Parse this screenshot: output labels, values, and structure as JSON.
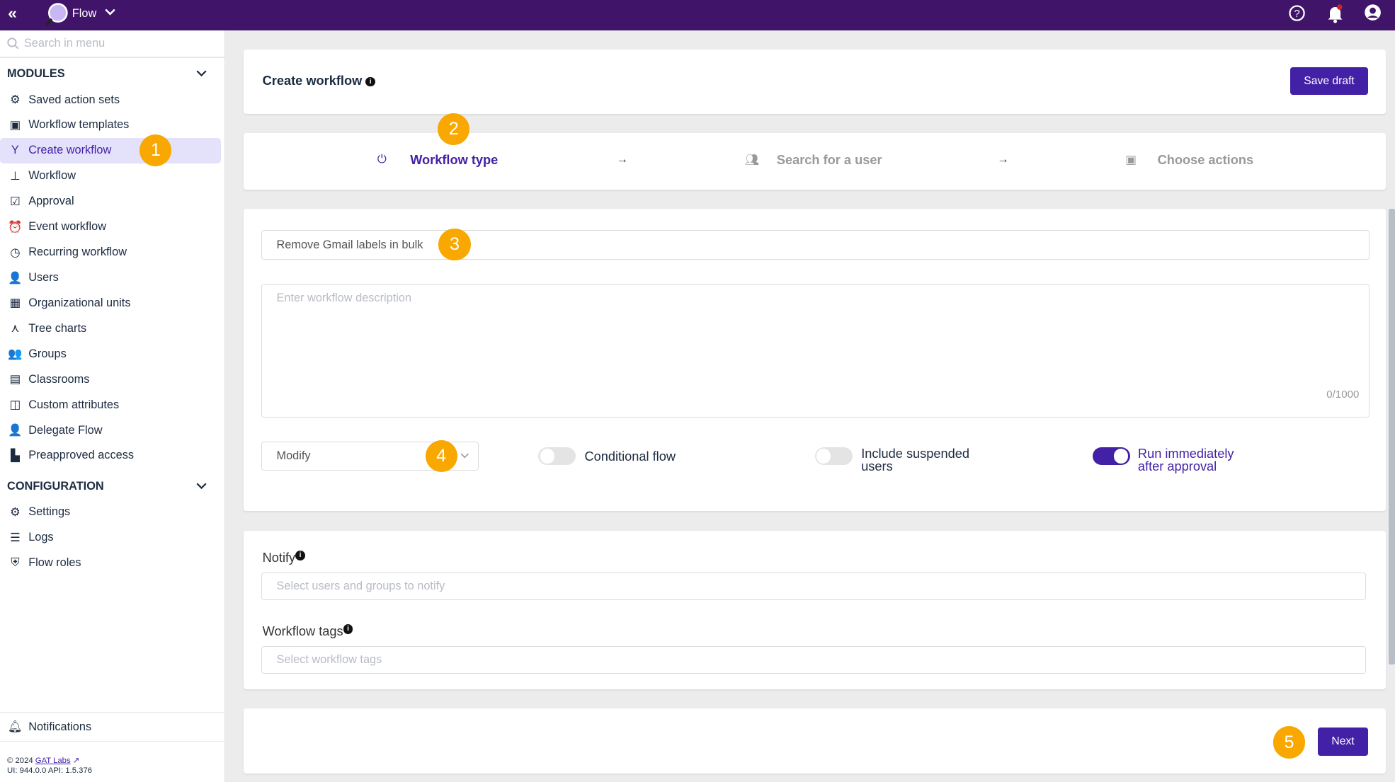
{
  "topbar": {
    "app_name": "Flow",
    "icons": [
      "collapse-icon",
      "flow-logo",
      "chevron-down-icon",
      "help-icon",
      "bell-icon",
      "account-icon"
    ],
    "background": "#3f1469"
  },
  "sidebar": {
    "search_placeholder": "Search in menu",
    "modules_title": "MODULES",
    "modules": [
      {
        "label": "Saved action sets",
        "icon": "gear-refresh-icon"
      },
      {
        "label": "Workflow templates",
        "icon": "template-icon"
      },
      {
        "label": "Create workflow",
        "icon": "fork-icon",
        "active": true
      },
      {
        "label": "Workflow",
        "icon": "sitemap-icon"
      },
      {
        "label": "Approval",
        "icon": "approval-icon"
      },
      {
        "label": "Event workflow",
        "icon": "alarm-icon"
      },
      {
        "label": "Recurring workflow",
        "icon": "clock-icon"
      },
      {
        "label": "Users",
        "icon": "user-search-icon"
      },
      {
        "label": "Organizational units",
        "icon": "building-icon"
      },
      {
        "label": "Tree charts",
        "icon": "tree-icon"
      },
      {
        "label": "Groups",
        "icon": "group-icon"
      },
      {
        "label": "Classrooms",
        "icon": "classroom-icon"
      },
      {
        "label": "Custom attributes",
        "icon": "attributes-icon"
      },
      {
        "label": "Delegate Flow",
        "icon": "delegate-icon"
      },
      {
        "label": "Preapproved access",
        "icon": "preapproved-icon"
      }
    ],
    "config_title": "CONFIGURATION",
    "config": [
      {
        "label": "Settings",
        "icon": "gear-icon"
      },
      {
        "label": "Logs",
        "icon": "list-icon"
      },
      {
        "label": "Flow roles",
        "icon": "shield-icon"
      }
    ],
    "notifications": "Notifications",
    "copyright": "© 2024",
    "company_link": "GAT Labs",
    "version": "UI: 944.0.0 API: 1.5.376"
  },
  "header": {
    "title": "Create workflow",
    "save_draft": "Save draft"
  },
  "steps": [
    {
      "label": "Workflow type",
      "active": true
    },
    {
      "label": "Search for a user"
    },
    {
      "label": "Choose actions"
    }
  ],
  "form": {
    "name_value": "Remove Gmail labels in bulk",
    "description_placeholder": "Enter workflow description",
    "char_count": "0/1000",
    "type_select": "Modify",
    "conditional_flow": {
      "label": "Conditional flow",
      "on": false
    },
    "include_suspended": {
      "label_line1": "Include suspended",
      "label_line2": "users",
      "on": false
    },
    "run_immediately": {
      "label_line1": "Run immediately",
      "label_line2": "after approval",
      "on": true
    }
  },
  "notify": {
    "label": "Notify",
    "placeholder": "Select users and groups to notify"
  },
  "tags": {
    "label": "Workflow tags",
    "placeholder": "Select workflow tags"
  },
  "footer": {
    "next": "Next"
  },
  "badges": [
    "1",
    "2",
    "3",
    "4",
    "5"
  ],
  "colors": {
    "primary": "#4321a6",
    "badge": "#f8a800",
    "active_bg": "#e4e1fb"
  }
}
